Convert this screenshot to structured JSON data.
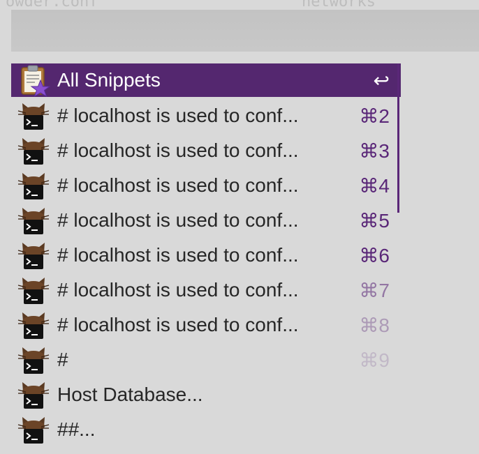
{
  "background": {
    "ghost_left": "owder.conf",
    "ghost_right": "networks"
  },
  "search": {
    "value": ""
  },
  "results": [
    {
      "label": "All Snippets",
      "shortcut": "↩",
      "icon": "clipboard-star-icon",
      "selected": true
    },
    {
      "label": "# localhost is used to conf...",
      "shortcut": "⌘2",
      "icon": "terminal-cat-icon"
    },
    {
      "label": "# localhost is used to conf...",
      "shortcut": "⌘3",
      "icon": "terminal-cat-icon"
    },
    {
      "label": "# localhost is used to conf...",
      "shortcut": "⌘4",
      "icon": "terminal-cat-icon"
    },
    {
      "label": "# localhost is used to conf...",
      "shortcut": "⌘5",
      "icon": "terminal-cat-icon"
    },
    {
      "label": "# localhost is used to conf...",
      "shortcut": "⌘6",
      "icon": "terminal-cat-icon"
    },
    {
      "label": "# localhost is used to conf...",
      "shortcut": "⌘7",
      "icon": "terminal-cat-icon"
    },
    {
      "label": "# localhost is used to conf...",
      "shortcut": "⌘8",
      "icon": "terminal-cat-icon"
    },
    {
      "label": "#",
      "shortcut": "⌘9",
      "icon": "terminal-cat-icon"
    },
    {
      "label": "Host Database...",
      "shortcut": "",
      "icon": "terminal-cat-icon"
    },
    {
      "label": "##...",
      "shortcut": "",
      "icon": "terminal-cat-icon"
    }
  ],
  "colors": {
    "accent": "#54276f",
    "shortcut": "#5a2778",
    "text": "#262626",
    "background": "#d9d9d9"
  }
}
